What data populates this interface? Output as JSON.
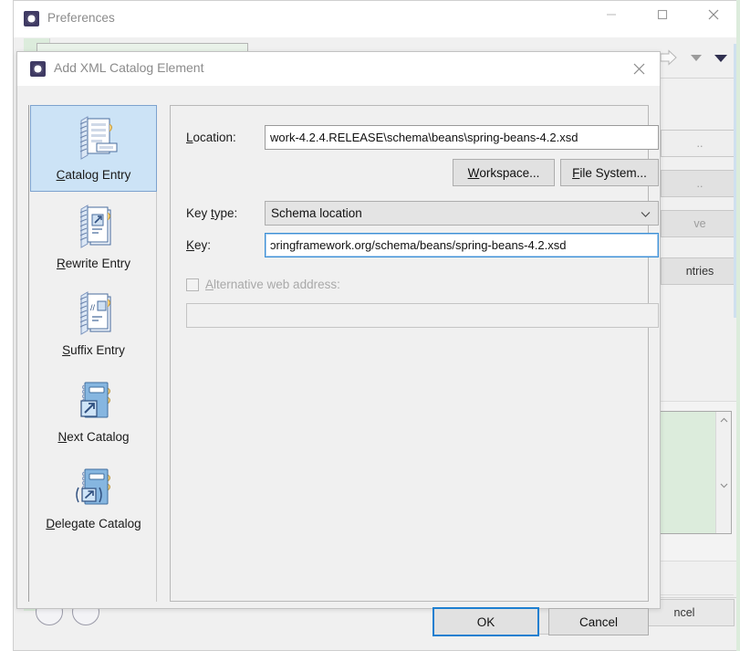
{
  "prefs_window": {
    "title": "Preferences",
    "icon": "eclipse-icon",
    "window_controls": {
      "minimize": "minimize-icon",
      "maximize": "maximize-icon",
      "close": "close-icon"
    },
    "toolbar_icons": [
      "arrow-right-icon",
      "triangle-down-icon",
      "triangle-down-filled-icon"
    ],
    "side_buttons": [
      {
        "label": "..",
        "enabled": false
      },
      {
        "label": "..",
        "enabled": false
      },
      {
        "label": "ve",
        "enabled": false
      },
      {
        "label": "ntries",
        "enabled": true
      }
    ],
    "scroll": {
      "up_arrow": "chevron-up-icon",
      "down_arrow": "chevron-down-icon",
      "expander": ">"
    },
    "bottom_button": "ncel"
  },
  "dialog": {
    "title": "Add XML Catalog Element",
    "icon": "eclipse-icon",
    "close_icon": "close-icon",
    "sidebar": [
      {
        "id": "catalog-entry",
        "label_pre": "C",
        "label_rest": "atalog Entry",
        "icon": "catalog-entry-icon",
        "selected": true
      },
      {
        "id": "rewrite-entry",
        "label_pre": "R",
        "label_rest": "ewrite Entry",
        "icon": "rewrite-entry-icon",
        "selected": false
      },
      {
        "id": "suffix-entry",
        "label_pre": "S",
        "label_rest": "uffix Entry",
        "icon": "suffix-entry-icon",
        "selected": false
      },
      {
        "id": "next-catalog",
        "label_pre": "N",
        "label_rest": "ext Catalog",
        "icon": "next-catalog-icon",
        "selected": false
      },
      {
        "id": "delegate-catalog",
        "label_pre": "D",
        "label_rest": "elegate Catalog",
        "icon": "delegate-catalog-icon",
        "selected": false
      }
    ],
    "form": {
      "location": {
        "label_pre": "L",
        "label_rest": "ocation:",
        "value": "work-4.2.4.RELEASE\\schema\\beans\\spring-beans-4.2.xsd"
      },
      "workspace_button": {
        "label_pre": "W",
        "label_rest": "orkspace..."
      },
      "filesystem_button": {
        "label_pre": "F",
        "label_rest": "ile System..."
      },
      "key_type": {
        "label_pre": "Key ",
        "label_mid": "t",
        "label_rest": "ype:",
        "value": "Schema location",
        "arrow": "chevron-down-icon"
      },
      "key": {
        "label_pre": "K",
        "label_rest": "ey:",
        "value": "ɔringframework.org/schema/beans/spring-beans-4.2.xsd"
      },
      "alt_web": {
        "label_pre": "A",
        "label_rest": "lternative web address:",
        "checked": false,
        "value": ""
      }
    },
    "buttons": {
      "ok": "OK",
      "cancel": "Cancel"
    }
  },
  "colors": {
    "selection_blue": "#cce3f6",
    "selection_border": "#7da2ce",
    "focus_blue": "#1d7fd0",
    "tree_green": "#dcecdc",
    "dialog_bg": "#f0f0f0",
    "eclipse_purple": "#3f3a63"
  }
}
